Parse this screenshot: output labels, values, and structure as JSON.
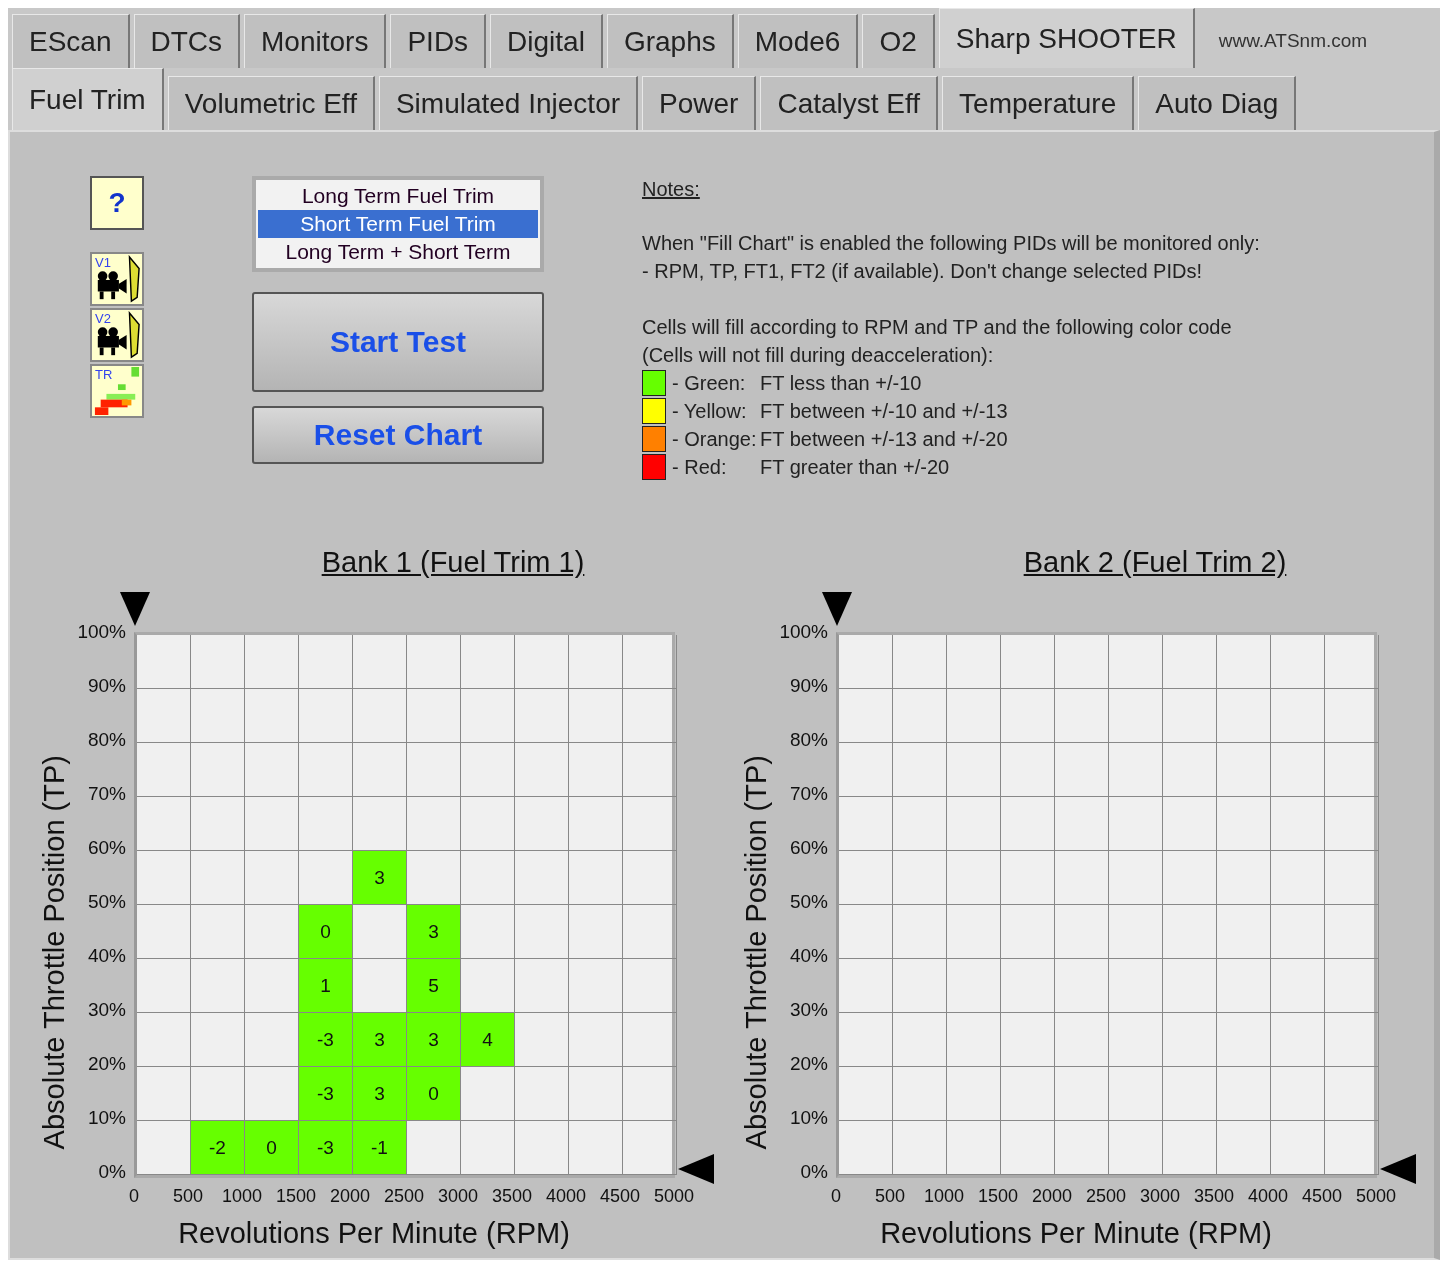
{
  "tabs": [
    {
      "label": "EScan",
      "selected": false
    },
    {
      "label": "DTCs",
      "selected": false
    },
    {
      "label": "Monitors",
      "selected": false
    },
    {
      "label": "PIDs",
      "selected": false
    },
    {
      "label": "Digital",
      "selected": false
    },
    {
      "label": "Graphs",
      "selected": false
    },
    {
      "label": "Mode6",
      "selected": false
    },
    {
      "label": "O2",
      "selected": false
    },
    {
      "label": "Sharp SHOOTER",
      "selected": true
    }
  ],
  "website": "www.ATSnm.com",
  "subtabs": [
    {
      "label": "Fuel Trim",
      "selected": true
    },
    {
      "label": "Volumetric Eff",
      "selected": false
    },
    {
      "label": "Simulated Injector",
      "selected": false
    },
    {
      "label": "Power",
      "selected": false
    },
    {
      "label": "Catalyst Eff",
      "selected": false
    },
    {
      "label": "Temperature",
      "selected": false
    },
    {
      "label": "Auto Diag",
      "selected": false
    }
  ],
  "help_button": "?",
  "tools": [
    {
      "kind": "video",
      "label": "V1"
    },
    {
      "kind": "video",
      "label": "V2"
    },
    {
      "kind": "chart",
      "label": "TR"
    }
  ],
  "trim_options": [
    {
      "label": "Long Term Fuel Trim",
      "selected": false
    },
    {
      "label": "Short Term Fuel Trim",
      "selected": true
    },
    {
      "label": "Long Term + Short Term",
      "selected": false
    }
  ],
  "buttons": {
    "start": "Start Test",
    "reset": "Reset Chart"
  },
  "notes": {
    "title": "Notes:",
    "paragraphs": [
      [
        "When \"Fill Chart\" is enabled the following PIDs will be monitored only:",
        "- RPM, TP, FT1, FT2 (if available).  Don't change selected PIDs!"
      ],
      [
        "Cells will fill according to RPM and TP and the following color code",
        "(Cells will not fill during deacceleration):"
      ]
    ],
    "legend": [
      {
        "name": "- Green:",
        "text": "FT less than +/-10",
        "color": "#66ff00"
      },
      {
        "name": "- Yellow:",
        "text": "FT between +/-10 and +/-13",
        "color": "#ffff00"
      },
      {
        "name": "- Orange:",
        "text": "FT between +/-13 and +/-20",
        "color": "#ff8000"
      },
      {
        "name": "- Red:",
        "text": "FT greater than +/-20",
        "color": "#ff0000"
      }
    ]
  },
  "charts": [
    {
      "title": "Bank 1 (Fuel Trim 1)",
      "ylabel": "Absolute Throttle Position (TP)",
      "xlabel": "Revolutions Per Minute (RPM)",
      "yticks": [
        "100%",
        "90%",
        "80%",
        "70%",
        "60%",
        "50%",
        "40%",
        "30%",
        "20%",
        "10%",
        "0%"
      ],
      "xticks": [
        "0",
        "500",
        "1000",
        "1500",
        "2000",
        "2500",
        "3000",
        "3500",
        "4000",
        "4500",
        "5000"
      ],
      "rows": [
        [
          null,
          null,
          null,
          null,
          null,
          null,
          null,
          null,
          null,
          null
        ],
        [
          null,
          null,
          null,
          null,
          null,
          null,
          null,
          null,
          null,
          null
        ],
        [
          null,
          null,
          null,
          null,
          null,
          null,
          null,
          null,
          null,
          null
        ],
        [
          null,
          null,
          null,
          null,
          null,
          null,
          null,
          null,
          null,
          null
        ],
        [
          null,
          null,
          null,
          null,
          {
            "value": "3",
            "color": "#66ff00"
          },
          null,
          null,
          null,
          null,
          null
        ],
        [
          null,
          null,
          null,
          {
            "value": "0",
            "color": "#66ff00"
          },
          null,
          {
            "value": "3",
            "color": "#66ff00"
          },
          null,
          null,
          null,
          null
        ],
        [
          null,
          null,
          null,
          {
            "value": "1",
            "color": "#66ff00"
          },
          null,
          {
            "value": "5",
            "color": "#66ff00"
          },
          null,
          null,
          null,
          null
        ],
        [
          null,
          null,
          null,
          {
            "value": "-3",
            "color": "#66ff00"
          },
          {
            "value": "3",
            "color": "#66ff00"
          },
          {
            "value": "3",
            "color": "#66ff00"
          },
          {
            "value": "4",
            "color": "#66ff00"
          },
          null,
          null,
          null
        ],
        [
          null,
          null,
          null,
          {
            "value": "-3",
            "color": "#66ff00"
          },
          {
            "value": "3",
            "color": "#66ff00"
          },
          {
            "value": "0",
            "color": "#66ff00"
          },
          null,
          null,
          null,
          null
        ],
        [
          null,
          {
            "value": "-2",
            "color": "#66ff00"
          },
          {
            "value": "0",
            "color": "#66ff00"
          },
          {
            "value": "-3",
            "color": "#66ff00"
          },
          {
            "value": "-1",
            "color": "#66ff00"
          },
          null,
          null,
          null,
          null,
          null
        ]
      ]
    },
    {
      "title": "Bank 2 (Fuel Trim 2)",
      "ylabel": "Absolute Throttle Position (TP)",
      "xlabel": "Revolutions Per Minute (RPM)",
      "yticks": [
        "100%",
        "90%",
        "80%",
        "70%",
        "60%",
        "50%",
        "40%",
        "30%",
        "20%",
        "10%",
        "0%"
      ],
      "xticks": [
        "0",
        "500",
        "1000",
        "1500",
        "2000",
        "2500",
        "3000",
        "3500",
        "4000",
        "4500",
        "5000"
      ],
      "rows": [
        [
          null,
          null,
          null,
          null,
          null,
          null,
          null,
          null,
          null,
          null
        ],
        [
          null,
          null,
          null,
          null,
          null,
          null,
          null,
          null,
          null,
          null
        ],
        [
          null,
          null,
          null,
          null,
          null,
          null,
          null,
          null,
          null,
          null
        ],
        [
          null,
          null,
          null,
          null,
          null,
          null,
          null,
          null,
          null,
          null
        ],
        [
          null,
          null,
          null,
          null,
          null,
          null,
          null,
          null,
          null,
          null
        ],
        [
          null,
          null,
          null,
          null,
          null,
          null,
          null,
          null,
          null,
          null
        ],
        [
          null,
          null,
          null,
          null,
          null,
          null,
          null,
          null,
          null,
          null
        ],
        [
          null,
          null,
          null,
          null,
          null,
          null,
          null,
          null,
          null,
          null
        ],
        [
          null,
          null,
          null,
          null,
          null,
          null,
          null,
          null,
          null,
          null
        ],
        [
          null,
          null,
          null,
          null,
          null,
          null,
          null,
          null,
          null,
          null
        ]
      ]
    }
  ]
}
